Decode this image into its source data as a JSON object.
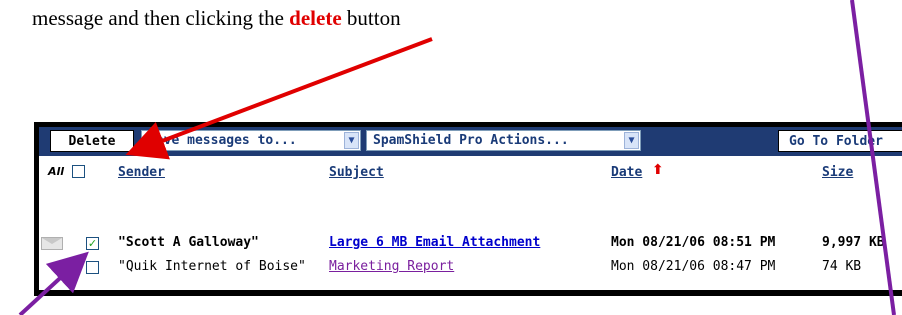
{
  "instruction": {
    "before": "message and then clicking the ",
    "keyword": "delete",
    "after": " button"
  },
  "toolbar": {
    "delete_label": "Delete",
    "move_select": "Move messages to...",
    "spam_select": "SpamShield Pro Actions...",
    "goto_label": "Go To Folder"
  },
  "columns": {
    "all": "All",
    "sender": "Sender",
    "subject": "Subject",
    "date": "Date",
    "size": "Size"
  },
  "messages": [
    {
      "sender": "\"Scott A Galloway\"",
      "subject": "Large 6 MB Email Attachment",
      "date": "Mon 08/21/06 08:51 PM",
      "size": "9,997 KB",
      "checked": true,
      "unread": true
    },
    {
      "sender": "\"Quik Internet of Boise\"",
      "subject": "Marketing Report",
      "date": "Mon 08/21/06 08:47 PM",
      "size": "74 KB",
      "checked": false,
      "unread": false
    }
  ],
  "icons": {
    "select_arrow": "chevron-down-icon",
    "sort": "sort-up-arrow-icon",
    "envelope": "envelope-icon",
    "checkmark": "checkmark-icon"
  },
  "colors": {
    "toolbar_bg": "#1f3b73",
    "annotation_red": "#e00000",
    "annotation_purple": "#7b1fa2",
    "link_blue": "#0000cc",
    "visited_purple": "#7a1f9e"
  }
}
